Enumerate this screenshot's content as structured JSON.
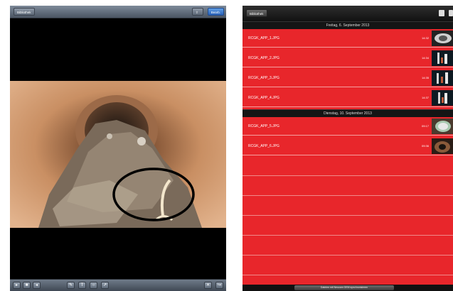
{
  "left": {
    "topbar": {
      "back_label": "Bibliothek",
      "share_label": "",
      "edit_label": "Bearb."
    },
    "photo": {
      "annotation": "ellipse"
    },
    "toolbar_icons": [
      "play-icon",
      "stop-icon",
      "rewind-icon",
      "draw-icon",
      "text-icon",
      "ellipse-icon",
      "arrow-icon",
      "trash-icon",
      "export-icon"
    ]
  },
  "right": {
    "topbar": {
      "back_label": "Bibliothek"
    },
    "sections": [
      {
        "header": "Freitag, 6. September 2013",
        "items": [
          {
            "name": "RCGK_APP_1.JPG",
            "time": "14:32"
          },
          {
            "name": "RCGK_APP_2.JPG",
            "time": "14:34"
          },
          {
            "name": "RCGK_APP_3.JPG",
            "time": "14:35"
          },
          {
            "name": "RCGK_APP_4.JPG",
            "time": "14:37"
          }
        ]
      },
      {
        "header": "Dienstag, 10. September 2013",
        "items": [
          {
            "name": "RCGK_APP_5.JPG",
            "time": "09:17"
          },
          {
            "name": "RCGK_APP_6.JPG",
            "time": "09:36"
          }
        ]
      }
    ],
    "bottom_label": "Dateien mit Neucam OEM synchronisieren",
    "colors": {
      "row_red": "#e8262b",
      "header_dark": "#151515"
    }
  }
}
